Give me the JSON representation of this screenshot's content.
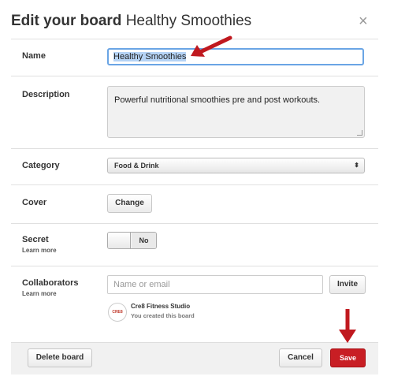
{
  "header": {
    "title_bold": "Edit your board",
    "title_board": "Healthy Smoothies",
    "close_glyph": "×"
  },
  "fields": {
    "name": {
      "label": "Name",
      "value": "Healthy Smoothies"
    },
    "description": {
      "label": "Description",
      "value": "Powerful nutritional smoothies pre and post workouts."
    },
    "category": {
      "label": "Category",
      "value": "Food & Drink",
      "arrow": "⬍"
    },
    "cover": {
      "label": "Cover",
      "button": "Change"
    },
    "secret": {
      "label": "Secret",
      "learn_more": "Learn more",
      "toggle_state": "No"
    },
    "collaborators": {
      "label": "Collaborators",
      "learn_more": "Learn more",
      "input_placeholder": "Name or email",
      "invite_button": "Invite",
      "owner_name": "Cre8 Fitness Studio",
      "owner_note": "You created this board",
      "avatar_text": "CRE8"
    }
  },
  "footer": {
    "delete_label": "Delete board",
    "cancel_label": "Cancel",
    "save_label": "Save"
  },
  "colors": {
    "save": "#c81e24",
    "annotation_arrow": "#c0191f",
    "focus_border": "#6aa5e5"
  },
  "icons": [
    "close-icon",
    "dropdown-arrow-icon",
    "annotation-arrow-icon"
  ]
}
